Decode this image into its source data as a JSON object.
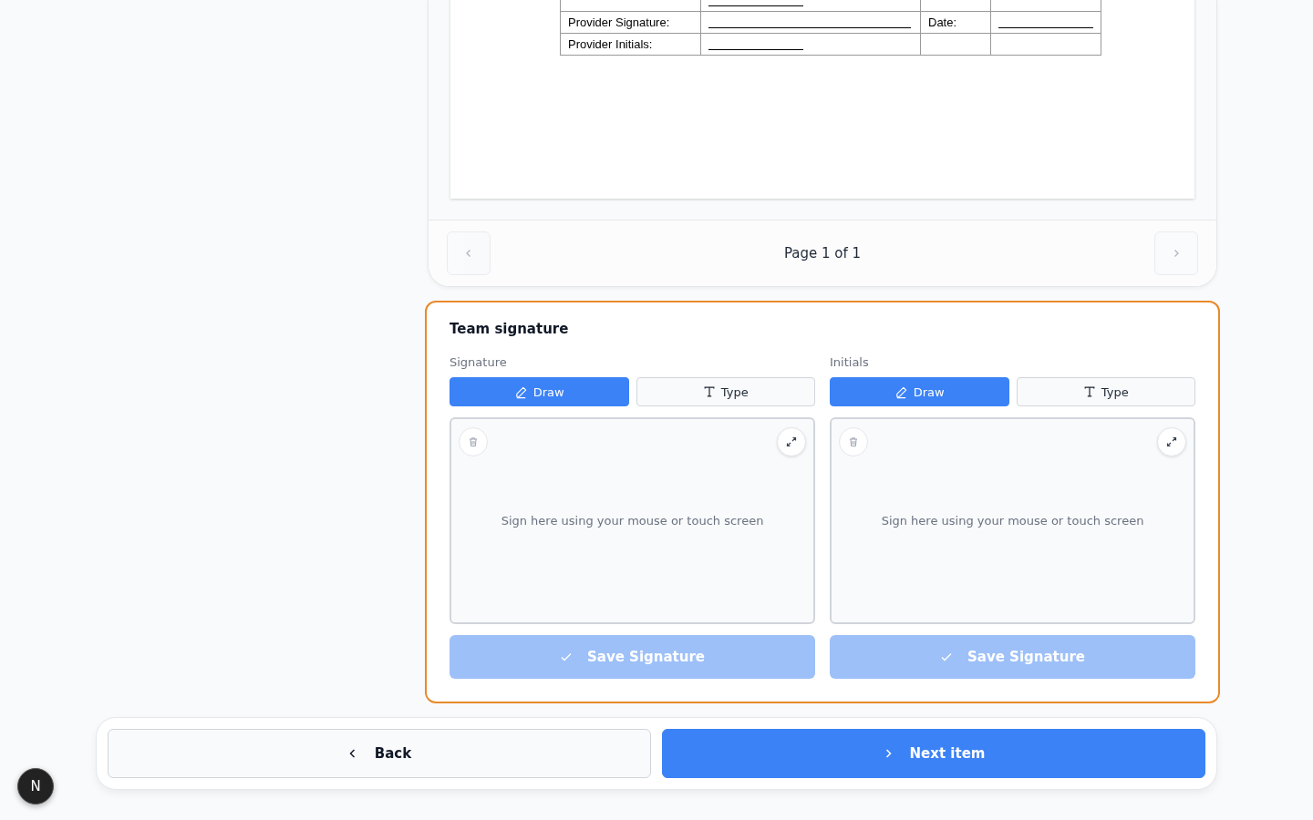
{
  "document": {
    "rows": [
      {
        "blank": true,
        "wide": false,
        "blank_2": false
      },
      {
        "label": "Provider Signature:",
        "blank": true,
        "wide": true,
        "label_2": "Date:",
        "blank_2": true
      },
      {
        "label": "Provider Initials:",
        "blank": true,
        "wide": false,
        "blank_2": false
      }
    ],
    "pager": {
      "text": "Page 1 of 1",
      "prev_disabled": true,
      "next_disabled": true
    }
  },
  "team_signature": {
    "title": "Team signature",
    "panels": [
      {
        "label": "Signature",
        "modes": [
          {
            "label": "Draw",
            "kind": "draw",
            "selected": true
          },
          {
            "label": "Type",
            "kind": "type",
            "selected": false
          }
        ],
        "hint": "Sign here using your mouse or touch screen",
        "save": "Save Signature",
        "save_disabled": true
      },
      {
        "label": "Initials",
        "modes": [
          {
            "label": "Draw",
            "kind": "draw",
            "selected": true
          },
          {
            "label": "Type",
            "kind": "type",
            "selected": false
          }
        ],
        "hint": "Sign here using your mouse or touch screen",
        "save": "Save Signature",
        "save_disabled": true
      }
    ]
  },
  "nav": {
    "back": "Back",
    "next": "Next item"
  },
  "dev_badge": "N"
}
